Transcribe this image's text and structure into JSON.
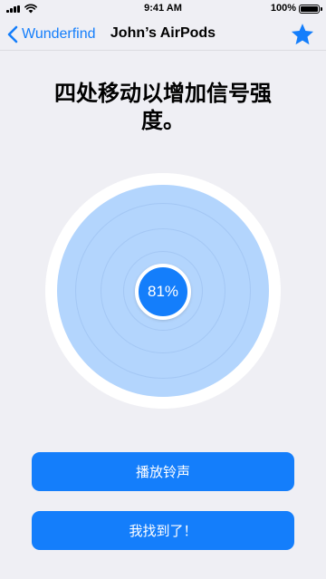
{
  "status_bar": {
    "time": "9:41 AM",
    "battery": "100%"
  },
  "nav": {
    "back_label": "Wunderfind",
    "title": "John’s AirPods",
    "star_icon": "star-icon"
  },
  "content": {
    "instruction": "四处移动以增加信号强度。",
    "signal_strength": "81%"
  },
  "actions": {
    "play_sound": "播放铃声",
    "found_it": "我找到了！"
  },
  "colors": {
    "accent": "#147efb",
    "signal_fill": "#b3d5fd",
    "background": "#efeff4"
  }
}
